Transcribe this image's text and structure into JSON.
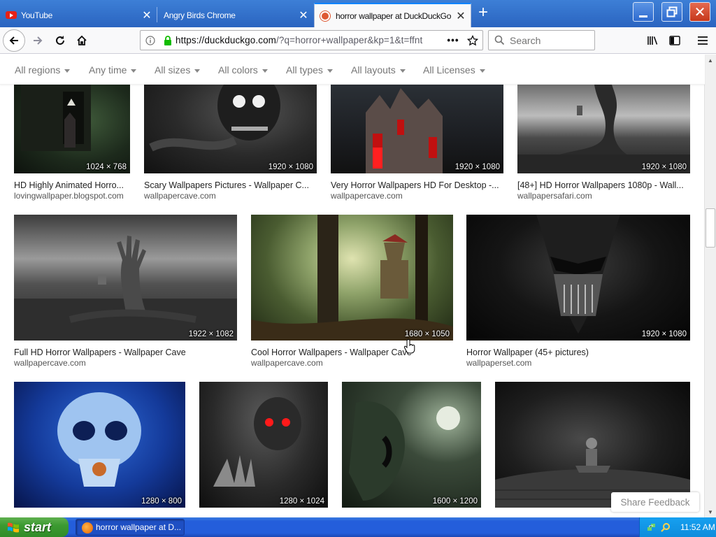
{
  "browser": {
    "tabs": [
      {
        "title": "YouTube",
        "icon": "youtube-icon",
        "active": false
      },
      {
        "title": "Angry Birds Chrome",
        "icon": "none",
        "active": false
      },
      {
        "title": "horror wallpaper at DuckDuckGo",
        "icon": "duckduckgo-icon",
        "active": true
      }
    ],
    "url": "https://duckduckgo.com/?q=horror+wallpaper&kp=1&t=ffnt",
    "url_host": "https://duckduckgo.com",
    "url_rest": "/?q=horror+wallpaper&kp=1&t=ffnt",
    "search_placeholder": "Search",
    "accent_color": "#0a84ff"
  },
  "filters": [
    {
      "label": "All regions"
    },
    {
      "label": "Any time"
    },
    {
      "label": "All sizes"
    },
    {
      "label": "All colors"
    },
    {
      "label": "All types"
    },
    {
      "label": "All layouts"
    },
    {
      "label": "All Licenses"
    }
  ],
  "results": [
    {
      "caption": "HD Highly Animated Horro...",
      "source": "lovingwallpaper.blogspot.com",
      "dims": "1024 × 768"
    },
    {
      "caption": "Scary Wallpapers Pictures - Wallpaper C...",
      "source": "wallpapercave.com",
      "dims": "1920 × 1080"
    },
    {
      "caption": "Very Horror Wallpapers HD For Desktop -...",
      "source": "wallpapercave.com",
      "dims": "1920 × 1080"
    },
    {
      "caption": "[48+] HD Horror Wallpapers 1080p - Wall...",
      "source": "wallpapersafari.com",
      "dims": "1920 × 1080"
    },
    {
      "caption": "Full HD Horror Wallpapers - Wallpaper Cave",
      "source": "wallpapercave.com",
      "dims": "1922 × 1082"
    },
    {
      "caption": "Cool Horror Wallpapers - Wallpaper Cave",
      "source": "wallpapercave.com",
      "dims": "1680 × 1050"
    },
    {
      "caption": "Horror Wallpaper (45+ pictures)",
      "source": "wallpaperset.com",
      "dims": "1920 × 1080"
    },
    {
      "caption": "",
      "source": "",
      "dims": "1280 × 800"
    },
    {
      "caption": "",
      "source": "",
      "dims": "1280 × 1024"
    },
    {
      "caption": "",
      "source": "",
      "dims": "1600 × 1200"
    },
    {
      "caption": "",
      "source": "",
      "dims": ""
    }
  ],
  "share_feedback": "Share Feedback",
  "taskbar": {
    "start_label": "start",
    "task_label": "horror wallpaper at D...",
    "clock": "11:52 AM"
  }
}
